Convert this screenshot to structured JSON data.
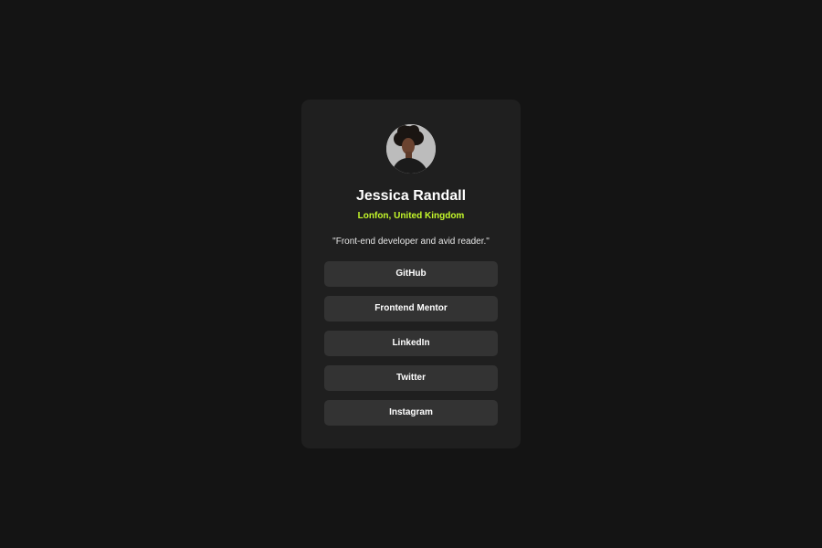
{
  "profile": {
    "name": "Jessica Randall",
    "location": "Lonfon, United Kingdom",
    "bio": "\"Front-end developer and avid reader.\"",
    "avatar_icon": "profile-photo"
  },
  "links": [
    {
      "label": "GitHub"
    },
    {
      "label": "Frontend Mentor"
    },
    {
      "label": "LinkedIn"
    },
    {
      "label": "Twitter"
    },
    {
      "label": "Instagram"
    }
  ],
  "colors": {
    "page_background": "#141414",
    "card_background": "#1f1f1f",
    "button_background": "#333333",
    "accent": "#c4f82a",
    "text": "#ffffff"
  }
}
